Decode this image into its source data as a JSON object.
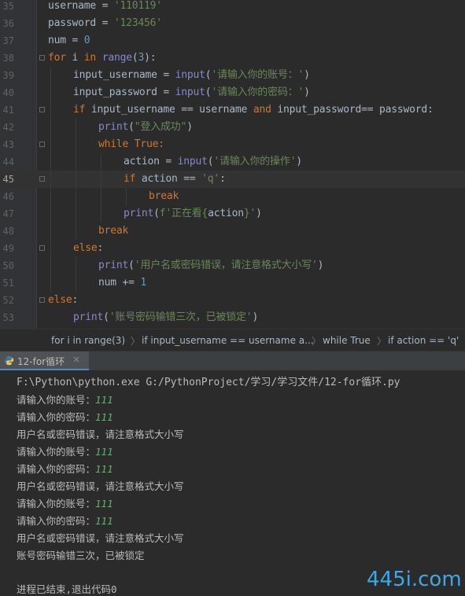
{
  "editor": {
    "current_line": "45",
    "lines": [
      {
        "num": "35",
        "t": [
          "username = ",
          "'110119'"
        ]
      },
      {
        "num": "36",
        "t": [
          "password = ",
          "'123456'"
        ]
      },
      {
        "num": "37",
        "t": [
          "num = ",
          "0"
        ]
      },
      {
        "num": "38",
        "t": [
          "for",
          " i ",
          "in",
          " ",
          "range",
          "(",
          "3",
          "):"
        ]
      },
      {
        "num": "39",
        "t": [
          "input_username = ",
          "input",
          "(",
          "'请输入你的账号：'",
          ")"
        ]
      },
      {
        "num": "40",
        "t": [
          "input_password = ",
          "input",
          "(",
          "'请输入你的密码：'",
          ")"
        ]
      },
      {
        "num": "41",
        "t": [
          "if",
          " input_username == username ",
          "and",
          " input_password== password:"
        ]
      },
      {
        "num": "42",
        "t": [
          "print",
          "(",
          "\"登入成功\"",
          ")"
        ]
      },
      {
        "num": "43",
        "t": [
          "while",
          " True:"
        ]
      },
      {
        "num": "44",
        "t": [
          "action = ",
          "input",
          "(",
          "'请输入你的操作'",
          ")"
        ]
      },
      {
        "num": "45",
        "t": [
          "if",
          " action == ",
          "'q'",
          ":"
        ]
      },
      {
        "num": "46",
        "t": [
          "break"
        ]
      },
      {
        "num": "47",
        "t": [
          "print",
          "(",
          "f'正在看{",
          "action",
          "}'",
          ")"
        ]
      },
      {
        "num": "48",
        "t": [
          "break"
        ]
      },
      {
        "num": "49",
        "t": [
          "else",
          ":"
        ]
      },
      {
        "num": "50",
        "t": [
          "print",
          "(",
          "'用户名或密码错误，请注意格式大小写'",
          ")"
        ]
      },
      {
        "num": "51",
        "t": [
          "num += ",
          "1"
        ]
      },
      {
        "num": "52",
        "t": [
          "else",
          ":"
        ]
      },
      {
        "num": "53",
        "t": [
          "print",
          "(",
          "'账号密码输错三次，已被锁定'",
          ")"
        ]
      }
    ]
  },
  "breadcrumb": [
    "for i in range(3)",
    "if input_username == username a...",
    "while True",
    "if action == 'q'"
  ],
  "run_tab": {
    "label": "12-for循环",
    "close": "×",
    "icon": "python-icon"
  },
  "console": {
    "command": "F:\\Python\\python.exe G:/PythonProject/学习/学习文件/12-for循环.py",
    "output": [
      {
        "prompt": "请输入你的账号：",
        "value": "111"
      },
      {
        "prompt": "请输入你的密码：",
        "value": "111"
      },
      {
        "prompt": "用户名或密码错误，请注意格式大小写",
        "value": ""
      },
      {
        "prompt": "请输入你的账号：",
        "value": "111"
      },
      {
        "prompt": "请输入你的密码：",
        "value": "111"
      },
      {
        "prompt": "用户名或密码错误，请注意格式大小写",
        "value": ""
      },
      {
        "prompt": "请输入你的账号：",
        "value": "111"
      },
      {
        "prompt": "请输入你的密码：",
        "value": "111"
      },
      {
        "prompt": "用户名或密码错误，请注意格式大小写",
        "value": ""
      },
      {
        "prompt": "账号密码输错三次，已被锁定",
        "value": ""
      }
    ],
    "exit_message": "进程已结束,退出代码0"
  },
  "watermark": "445i.com",
  "colors": {
    "keyword": "#cc7832",
    "string": "#6a8759",
    "number": "#6897bb",
    "builtin": "#8888c6",
    "input_echo": "#6aab73",
    "accent": "#4a88c7",
    "watermark": "#3ea8e5"
  }
}
